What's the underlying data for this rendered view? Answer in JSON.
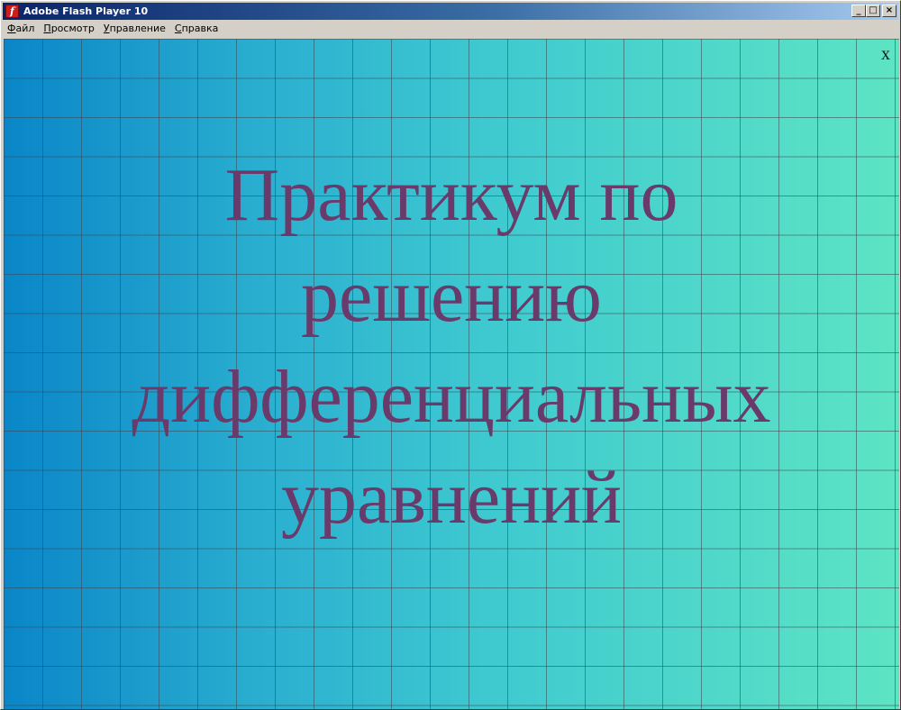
{
  "window": {
    "title": "Adobe Flash Player 10",
    "icon_letter": "f",
    "buttons": {
      "minimize": "_",
      "maximize": "□",
      "close": "×"
    }
  },
  "menu": {
    "items": [
      {
        "label": "Файл"
      },
      {
        "label": "Просмотр"
      },
      {
        "label": "Управление"
      },
      {
        "label": "Справка"
      }
    ]
  },
  "stage": {
    "close_label": "x",
    "title_lines": [
      "Практикум по",
      "решению",
      "дифференциальных",
      "уравнений"
    ]
  },
  "colors": {
    "title_text": "#6a3a6a",
    "background_left": "#0a86c8",
    "background_right": "#5de4c4",
    "grid_line": "#3c4650"
  }
}
